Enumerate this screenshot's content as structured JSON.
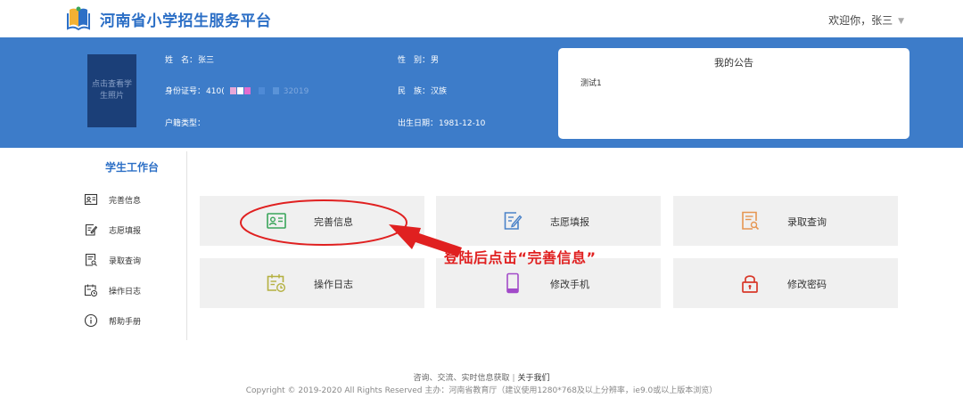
{
  "header": {
    "site_title": "河南省小学招生服务平台",
    "user_greeting": "欢迎你，张三",
    "caret": "▼"
  },
  "profile": {
    "photo_placeholder": "点击查看学生照片",
    "name_label": "姓　名：",
    "name_value": "张三",
    "id_label": "身份证号：",
    "id_prefix": "410(",
    "id_suffix": "32019",
    "household_label": "户籍类型：",
    "household_value": "",
    "gender_label": "性　别：",
    "gender_value": "男",
    "ethnicity_label": "民　族：",
    "ethnicity_value": "汉族",
    "birth_label": "出生日期：",
    "birth_value": "1981-12-10"
  },
  "notice": {
    "title": "我的公告",
    "items": [
      "测试1"
    ]
  },
  "sidebar": {
    "title": "学生工作台",
    "items": [
      {
        "label": "完善信息",
        "icon": "id-card-icon"
      },
      {
        "label": "志愿填报",
        "icon": "edit-form-icon"
      },
      {
        "label": "录取查询",
        "icon": "document-search-icon"
      },
      {
        "label": "操作日志",
        "icon": "calendar-clock-icon"
      },
      {
        "label": "帮助手册",
        "icon": "info-circle-icon"
      }
    ]
  },
  "tiles": [
    {
      "label": "完善信息",
      "icon": "id-card-icon",
      "color": "#3aa55a"
    },
    {
      "label": "志愿填报",
      "icon": "edit-form-icon",
      "color": "#4a82c8"
    },
    {
      "label": "录取查询",
      "icon": "document-search-icon",
      "color": "#e69652"
    },
    {
      "label": "操作日志",
      "icon": "calendar-clock-icon",
      "color": "#b4b040"
    },
    {
      "label": "修改手机",
      "icon": "phone-icon",
      "color": "#a24bc9"
    },
    {
      "label": "修改密码",
      "icon": "lock-icon",
      "color": "#d8382a"
    }
  ],
  "annotation": {
    "text": "登陆后点击“完善信息”",
    "color": "#e02020"
  },
  "footer": {
    "links_text": "咨询、交流、实时信息获取",
    "about_link": "关于我们",
    "copyright": "Copyright © 2019-2020 All Rights Reserved 主办：河南省教育厅（建议使用1280*768及以上分辨率，ie9.0或以上版本浏览）"
  },
  "colors": {
    "brand_blue": "#2c6fc6",
    "banner_blue": "#3d7cc9",
    "tile_bg": "#f0f0f0"
  }
}
